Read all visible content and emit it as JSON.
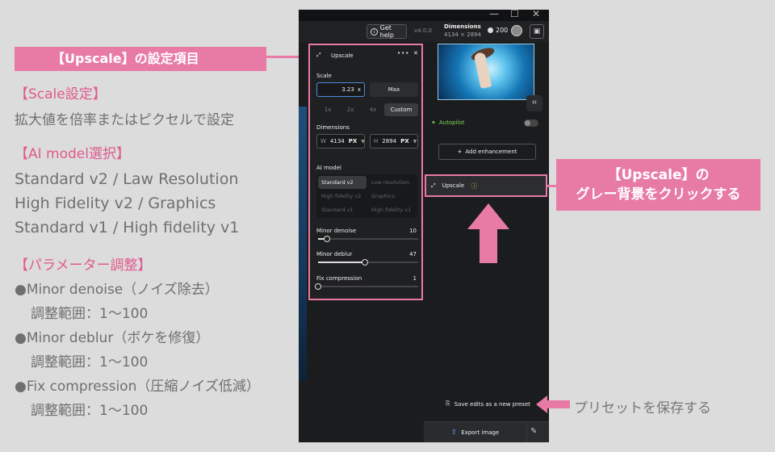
{
  "annotations": {
    "title_banner": "【Upscale】の設定項目",
    "scale_heading": "【Scale設定】",
    "scale_desc": "拡大値を倍率またはピクセルで設定",
    "model_heading": "【AI model選択】",
    "model_line1": "Standard v2 / Law Resolution",
    "model_line2": "High Fidelity v2 / Graphics",
    "model_line3": "Standard v1  / High fidelity v1",
    "param_heading": "【パラメーター調整】",
    "param1": "●Minor denoise（ノイズ除去）",
    "param1_range": "調整範囲：1〜100",
    "param2": "●Minor deblur（ボケを修復）",
    "param2_range": "調整範囲：1〜100",
    "param3": "●Fix compression（圧縮ノイズ低減）",
    "param3_range": "調整範囲：1〜100",
    "callout_line1": "【Upscale】の",
    "callout_line2": "グレー背景をクリックする",
    "preset_note": "プリセットを保存する"
  },
  "window_controls": {
    "minimize": "—",
    "maximize": "☐",
    "close": "✕"
  },
  "topbar": {
    "help": "Get help",
    "version": "v4.0.0",
    "dimensions_label": "Dimensions",
    "dimensions_value": "4134 × 2894",
    "credits": "200"
  },
  "settings": {
    "title": "Upscale",
    "more": "•••",
    "close": "✕",
    "scale_label": "Scale",
    "scale_value": "3.23",
    "scale_unit": "x",
    "max_label": "Max",
    "presets": [
      "1x",
      "2x",
      "4x",
      "Custom"
    ],
    "dimensions_label": "Dimensions",
    "width_key": "W",
    "width_value": "4134",
    "height_key": "H",
    "height_value": "2894",
    "unit": "PX",
    "ai_model_label": "AI model",
    "models": [
      "Standard v2",
      "Low resolution",
      "High fidelity v2",
      "Graphics",
      "Standard v1",
      "High fidelity v1"
    ],
    "selected_model": "Standard v2",
    "sliders": [
      {
        "label": "Minor denoise",
        "value": 10
      },
      {
        "label": "Minor deblur",
        "value": 47
      },
      {
        "label": "Fix compression",
        "value": 1
      }
    ]
  },
  "right_panel": {
    "autopilot": "Autopilot",
    "add_enhancement": "Add enhancement",
    "upscale_item": "Upscale",
    "save_preset": "Save edits as a new preset",
    "export": "Export image"
  },
  "colors": {
    "accent_pink": "#e87aa6",
    "autopilot_green": "#7ddc5a",
    "warning": "#e3b23c",
    "export_blue": "#5aa8ff"
  }
}
